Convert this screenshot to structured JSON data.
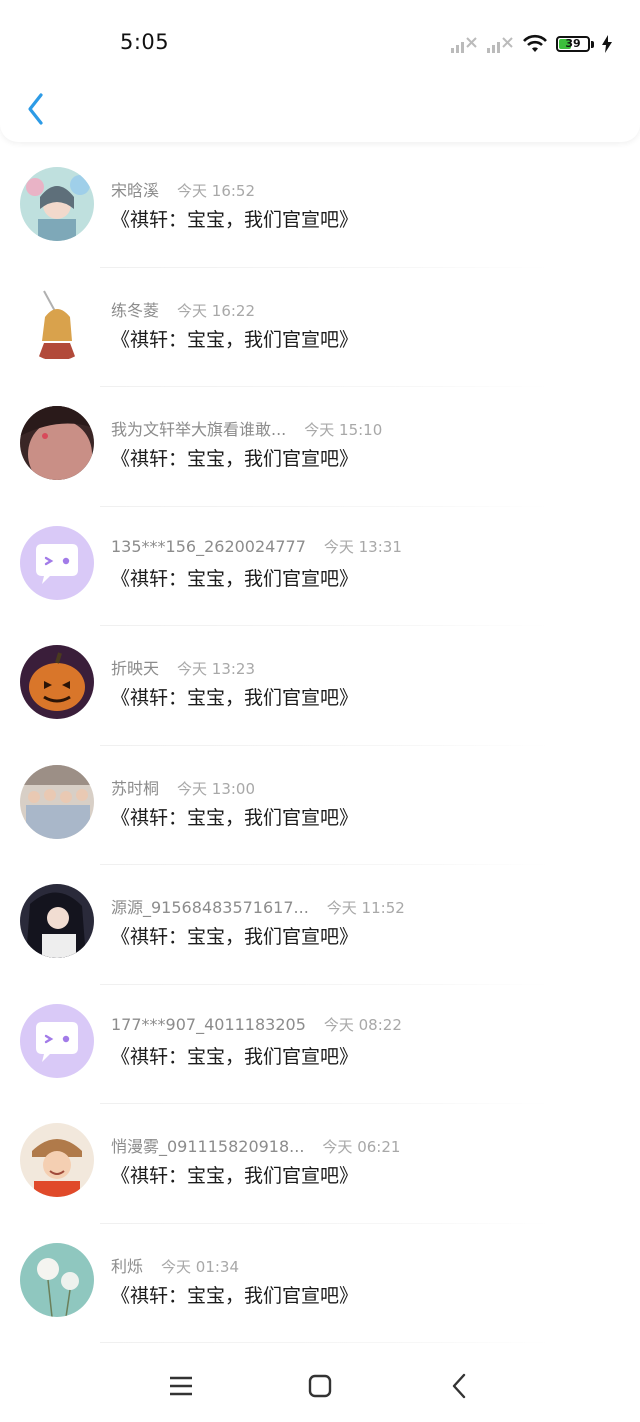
{
  "status_bar": {
    "time": "5:05",
    "battery_level": "39"
  },
  "header": {
    "back_icon": "chevron-left-icon"
  },
  "messages": [
    {
      "name": "宋晗溪",
      "time": "今天 16:52",
      "text": "《祺轩：宝宝，我们官宣吧》",
      "avatar": "avatar-illustration-flowers"
    },
    {
      "name": "练冬菱",
      "time": "今天 16:22",
      "text": "《祺轩：宝宝，我们官宣吧》",
      "avatar": "avatar-anime-swordsman"
    },
    {
      "name": "我为文轩举大旗看谁敢...",
      "time": "今天 15:10",
      "text": "《祺轩：宝宝，我们官宣吧》",
      "avatar": "avatar-face-closeup"
    },
    {
      "name": "135***156_2620024777",
      "time": "今天 13:31",
      "text": "《祺轩：宝宝，我们官宣吧》",
      "avatar": "default-chat-avatar-icon"
    },
    {
      "name": "折映天",
      "time": "今天 13:23",
      "text": "《祺轩：宝宝，我们官宣吧》",
      "avatar": "avatar-pumpkin"
    },
    {
      "name": "苏时桐",
      "time": "今天 13:00",
      "text": "《祺轩：宝宝，我们官宣吧》",
      "avatar": "avatar-group-photo"
    },
    {
      "name": "源源_91568483571617...",
      "time": "今天 11:52",
      "text": "《祺轩：宝宝，我们官宣吧》",
      "avatar": "avatar-anime-girl"
    },
    {
      "name": "177***907_4011183205",
      "time": "今天 08:22",
      "text": "《祺轩：宝宝，我们官宣吧》",
      "avatar": "default-chat-avatar-icon"
    },
    {
      "name": "悄漫雾_091115820918...",
      "time": "今天 06:21",
      "text": "《祺轩：宝宝，我们官宣吧》",
      "avatar": "avatar-boy-hat"
    },
    {
      "name": "利烁",
      "time": "今天 01:34",
      "text": "《祺轩：宝宝，我们官宣吧》",
      "avatar": "avatar-dandelion"
    }
  ],
  "nav_bar": {
    "menu_icon": "menu-icon",
    "home_icon": "home-icon",
    "back_icon": "back-icon"
  },
  "colors": {
    "accent": "#2d9be6",
    "default_avatar_bg": "#d9c9f7",
    "default_avatar_fg": "#a27be8"
  }
}
